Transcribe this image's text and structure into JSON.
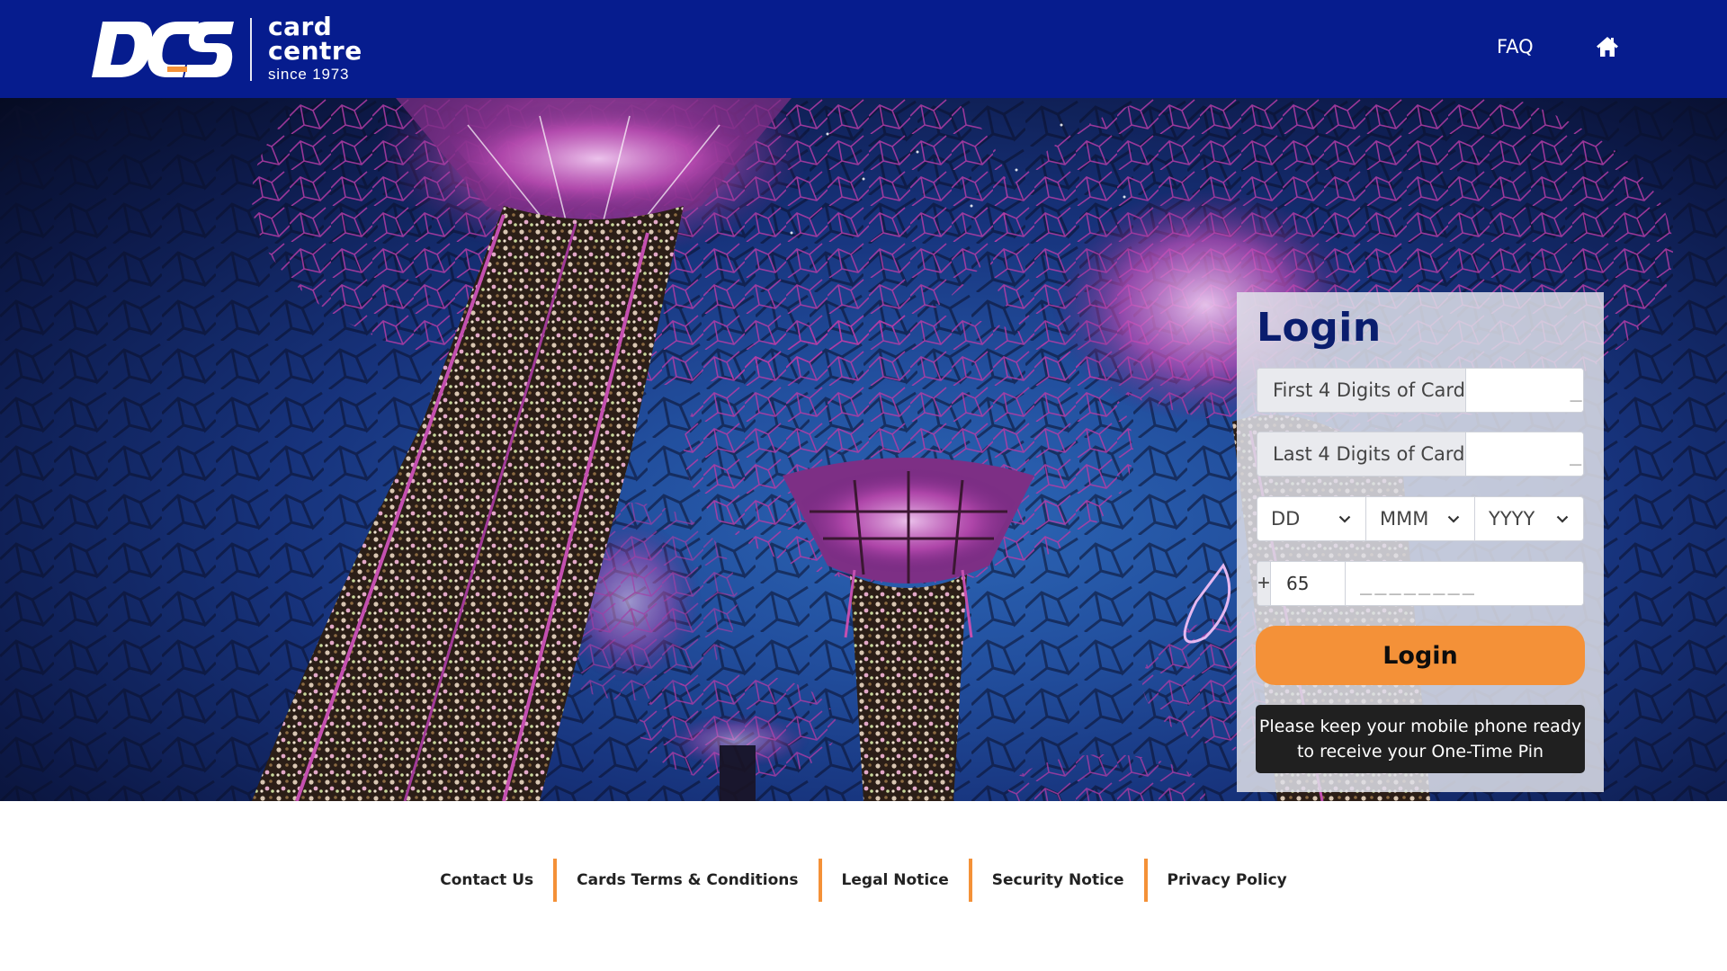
{
  "header": {
    "logo": {
      "mark_text": "DCS",
      "line1": "card",
      "line2": "centre",
      "line3": "since 1973"
    },
    "nav": {
      "faq_label": "FAQ",
      "home_icon": "home-icon"
    },
    "background_color": "#061c8e"
  },
  "login": {
    "title": "Login",
    "first_digits_label": "First 4 Digits of Card",
    "first_digits_placeholder": "____",
    "last_digits_label": "Last 4 Digits of Card",
    "last_digits_placeholder": "____",
    "dob": {
      "day_value": "DD",
      "month_value": "MMM",
      "year_value": "YYYY"
    },
    "phone": {
      "plus_symbol": "+",
      "country_code": "65",
      "number_placeholder": "________"
    },
    "submit_label": "Login",
    "notice_line1": "Please keep your mobile phone ready",
    "notice_line2": "to receive your One-Time Pin"
  },
  "footer": {
    "links": [
      "Contact Us",
      "Cards Terms & Conditions",
      "Legal Notice",
      "Security Notice",
      "Privacy Policy"
    ]
  },
  "colors": {
    "brand_blue": "#061c8e",
    "accent_orange": "#f49138",
    "title_navy": "#0a1d6e"
  }
}
